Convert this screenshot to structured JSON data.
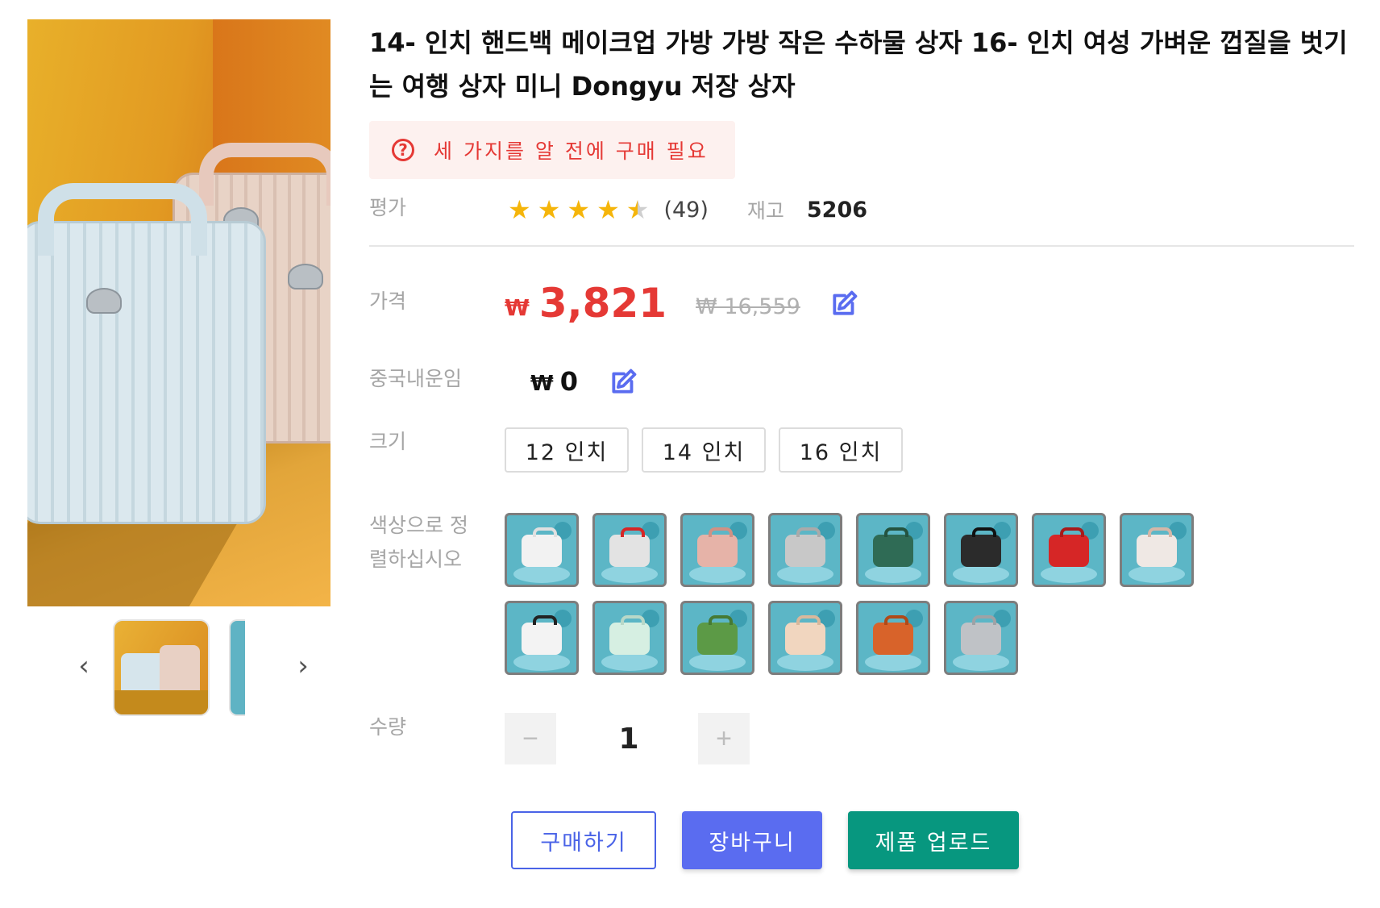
{
  "product": {
    "title": "14- 인치 핸드백 메이크업 가방 가방 작은 수하물 상자 16- 인치 여성 가벼운 껍질을 벗기는 여행 상자 미니 Dongyu 저장 상자",
    "notice": "세 가지를 알 전에 구매 필요",
    "rating": {
      "label": "평가",
      "stars": 4.5,
      "review_count": "(49)"
    },
    "stock": {
      "label": "재고",
      "value": "5206"
    },
    "price": {
      "label": "가격",
      "currency": "₩",
      "value": "3,821",
      "original": "₩ 16,559"
    },
    "shipping": {
      "label": "중국내운임",
      "currency": "₩",
      "value": "0"
    },
    "size": {
      "label": "크기",
      "options": [
        "12 인치",
        "14 인치",
        "16 인치"
      ]
    },
    "color": {
      "label_line1": "색상으로 정",
      "label_line2": "렬하십시오",
      "swatches": [
        "#f2f2f2",
        "#e3e3e3",
        "#e6b3a8",
        "#c8c8c8",
        "#2f6b55",
        "#2b2b2b",
        "#d62626",
        "#efe8e4",
        "#f3f3f3",
        "#d6efe2",
        "#5c9a46",
        "#f1d6bf",
        "#d8632a",
        "#bfc2c6"
      ],
      "accents": [
        "#e0e0e0",
        "#d62626",
        "#d09184",
        "#aaaaaa",
        "#24533f",
        "#111111",
        "#a81a1a",
        "#d4b7a8",
        "#222222",
        "#b8d8c8",
        "#467a34",
        "#d8b89c",
        "#b04a18",
        "#9ea2a6"
      ]
    },
    "quantity": {
      "label": "수량",
      "value": "1",
      "minus": "−",
      "plus": "+"
    },
    "actions": {
      "buy": "구매하기",
      "cart": "장바구니",
      "upload": "제품 업로드"
    },
    "colors": {
      "price_red": "#e53935",
      "accent_blue": "#5a6cf0",
      "upload_green": "#07977f",
      "star": "#f5b50a"
    }
  },
  "gallery": {
    "prev": "‹",
    "next": "›"
  }
}
